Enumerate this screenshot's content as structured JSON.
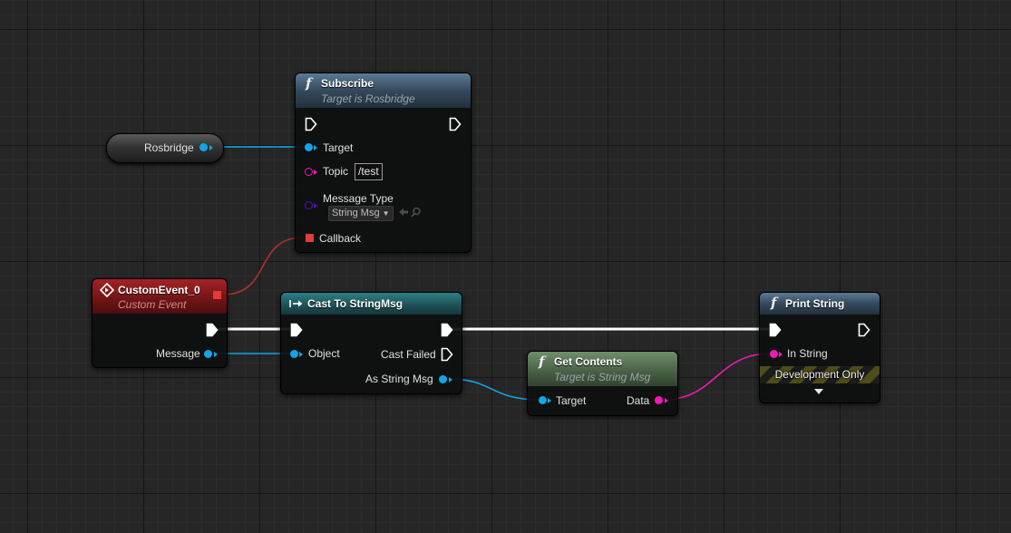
{
  "colors": {
    "exec": "#ffffff",
    "object": "#10a6e7",
    "string": "#f21ab6",
    "structure": "#5012b8",
    "delegate": "#e33b3b"
  },
  "rosbridge_var": {
    "label": "Rosbridge"
  },
  "subscribe_node": {
    "title": "Subscribe",
    "subtitle": "Target is Rosbridge",
    "target_label": "Target",
    "topic_label": "Topic",
    "topic_value": "/test",
    "message_type_label": "Message Type",
    "message_type_value": "String Msg",
    "callback_label": "Callback"
  },
  "custom_event_node": {
    "title": "CustomEvent_0",
    "subtitle": "Custom Event",
    "message_label": "Message"
  },
  "cast_node": {
    "title": "Cast To StringMsg",
    "object_label": "Object",
    "cast_failed_label": "Cast Failed",
    "as_string_msg_label": "As String Msg"
  },
  "get_contents_node": {
    "title": "Get Contents",
    "subtitle": "Target is String Msg",
    "target_label": "Target",
    "data_label": "Data"
  },
  "print_string_node": {
    "title": "Print String",
    "in_string_label": "In String",
    "dev_only_label": "Development Only"
  }
}
